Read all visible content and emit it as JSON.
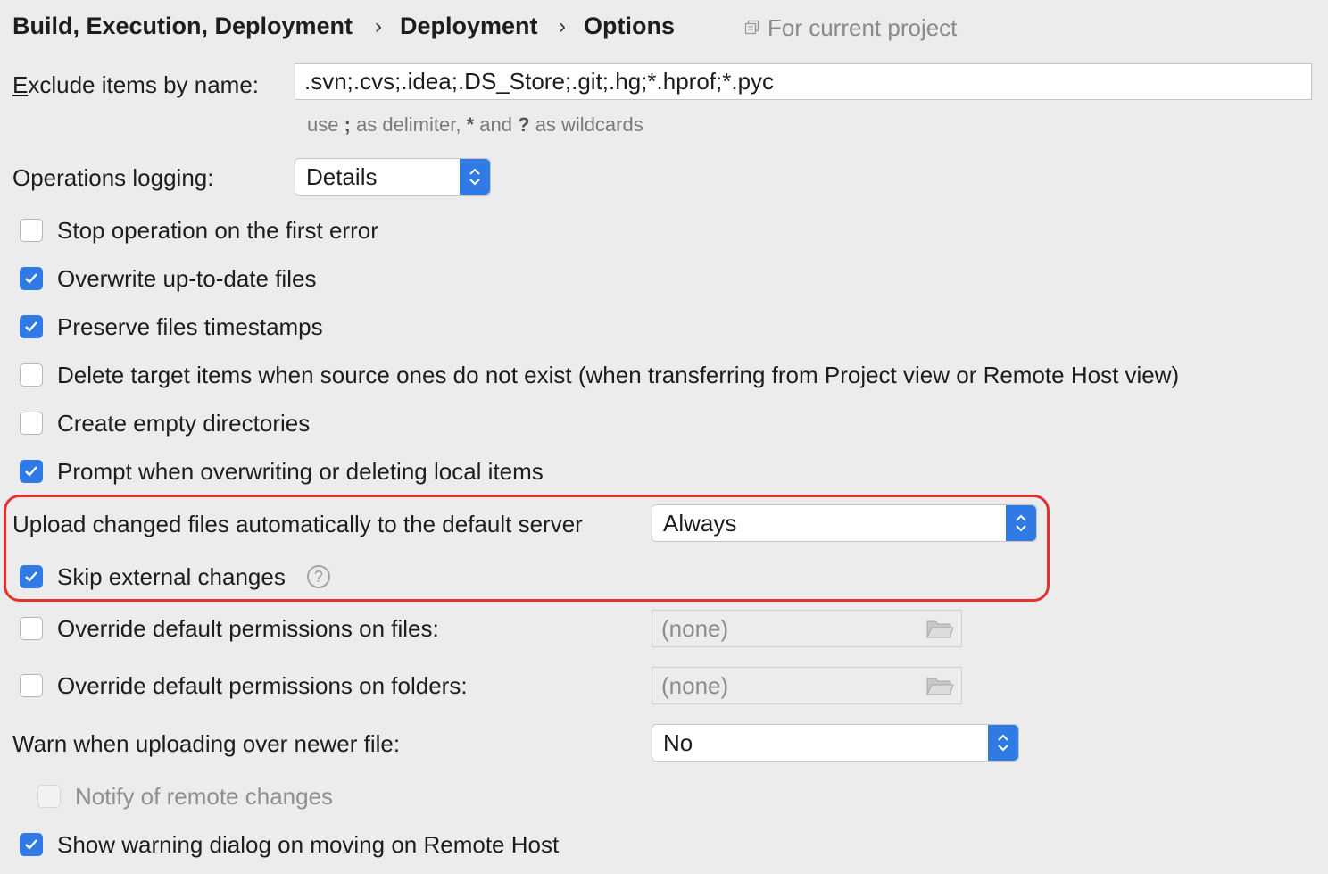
{
  "breadcrumb": {
    "items": [
      "Build, Execution, Deployment",
      "Deployment",
      "Options"
    ],
    "separator": "›",
    "scope_label": "For current project",
    "scope_icon": "copy-icon"
  },
  "exclude": {
    "label_first": "E",
    "label_rest": "xclude items by name:",
    "value": ".svn;.cvs;.idea;.DS_Store;.git;.hg;*.hprof;*.pyc",
    "hint_use": "use",
    "hint_semicolon": ";",
    "hint_as_delim": "as delimiter,",
    "hint_star": "*",
    "hint_and": "and",
    "hint_q": "?",
    "hint_as_wild": "as wildcards"
  },
  "logging": {
    "label": "Operations logging:",
    "value": "Details"
  },
  "options": [
    {
      "label": "Stop operation on the first error",
      "checked": false
    },
    {
      "label": "Overwrite up-to-date files",
      "checked": true
    },
    {
      "label": "Preserve files timestamps",
      "checked": true
    },
    {
      "label": "Delete target items when source ones do not exist (when transferring from Project view or Remote Host view)",
      "checked": false
    },
    {
      "label": "Create empty directories",
      "checked": false
    },
    {
      "label": "Prompt when overwriting or deleting local items",
      "checked": true
    }
  ],
  "upload": {
    "label": "Upload changed files automatically to the default server",
    "value": "Always",
    "skip_label": "Skip external changes",
    "skip_checked": true,
    "help_glyph": "?"
  },
  "permissions": {
    "files_label": "Override default permissions on files:",
    "files_value": "(none)",
    "folders_label": "Override default permissions on folders:",
    "folders_value": "(none)"
  },
  "warn": {
    "label": "Warn when uploading over newer file:",
    "value": "No"
  },
  "notify": {
    "label": "Notify of remote changes",
    "checked": false,
    "disabled": true
  },
  "show_warning": {
    "label": "Show warning dialog on moving on Remote Host",
    "checked": true
  },
  "colors": {
    "accent": "#2f7ae5",
    "highlight": "#e8302b",
    "background": "#ececec"
  }
}
